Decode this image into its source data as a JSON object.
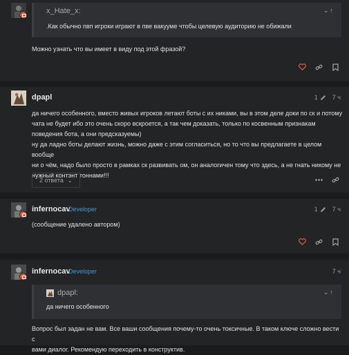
{
  "posts": [
    {
      "quote": {
        "author": "x_Hate_x:",
        "text": ".Как обычно пвп игроки играют в пве вакууме чтобы целевую аудиторию не обижали"
      },
      "body": "Можно узнать что вы имеет в виду под этой фразой?"
    },
    {
      "username": "dpapl",
      "edits": "1",
      "time": "7 ч",
      "lines": [
        "да ничего особенного, вместо живых игроков летают боты с их никами, вы в этом деле доки по ск и потому",
        "чата не будет ибо это очень скоро вскроется, а так чем доказать, только по косвенным признакам",
        "поведения бота, а они предсказуемы)",
        "ну да ладно боты делают жизнь, можно даже с этим согласиться, но то что вы предлагаете в целом вообще",
        "ни о чём, надо было просто в рамках ск развивать ом, он аналогичен тому что здесь, а не гнать никому не",
        "нужный контэнт тоннами!!!"
      ],
      "replies_label": "2 ответа"
    },
    {
      "username": "infernocav",
      "role": "Developer",
      "edits": "1",
      "time": "7 ч",
      "body": "(сообщение удалено автором)"
    },
    {
      "username": "infernocav",
      "role": "Developer",
      "time": "7 ч",
      "quote": {
        "author": "dpapl:",
        "text": "да ничего особенного"
      },
      "lines": [
        "Вопрос был задан не вам. Все ваши сообщения почему-то очень токсичные. В таком ключе сложно вести с",
        "вами диалог. Рекомендую переходить в конструктив."
      ]
    }
  ],
  "colors": {
    "accent_role": "#3f9ad8",
    "like": "#e2573b",
    "background": "#1a1b1d",
    "post_bg": "#232426"
  }
}
